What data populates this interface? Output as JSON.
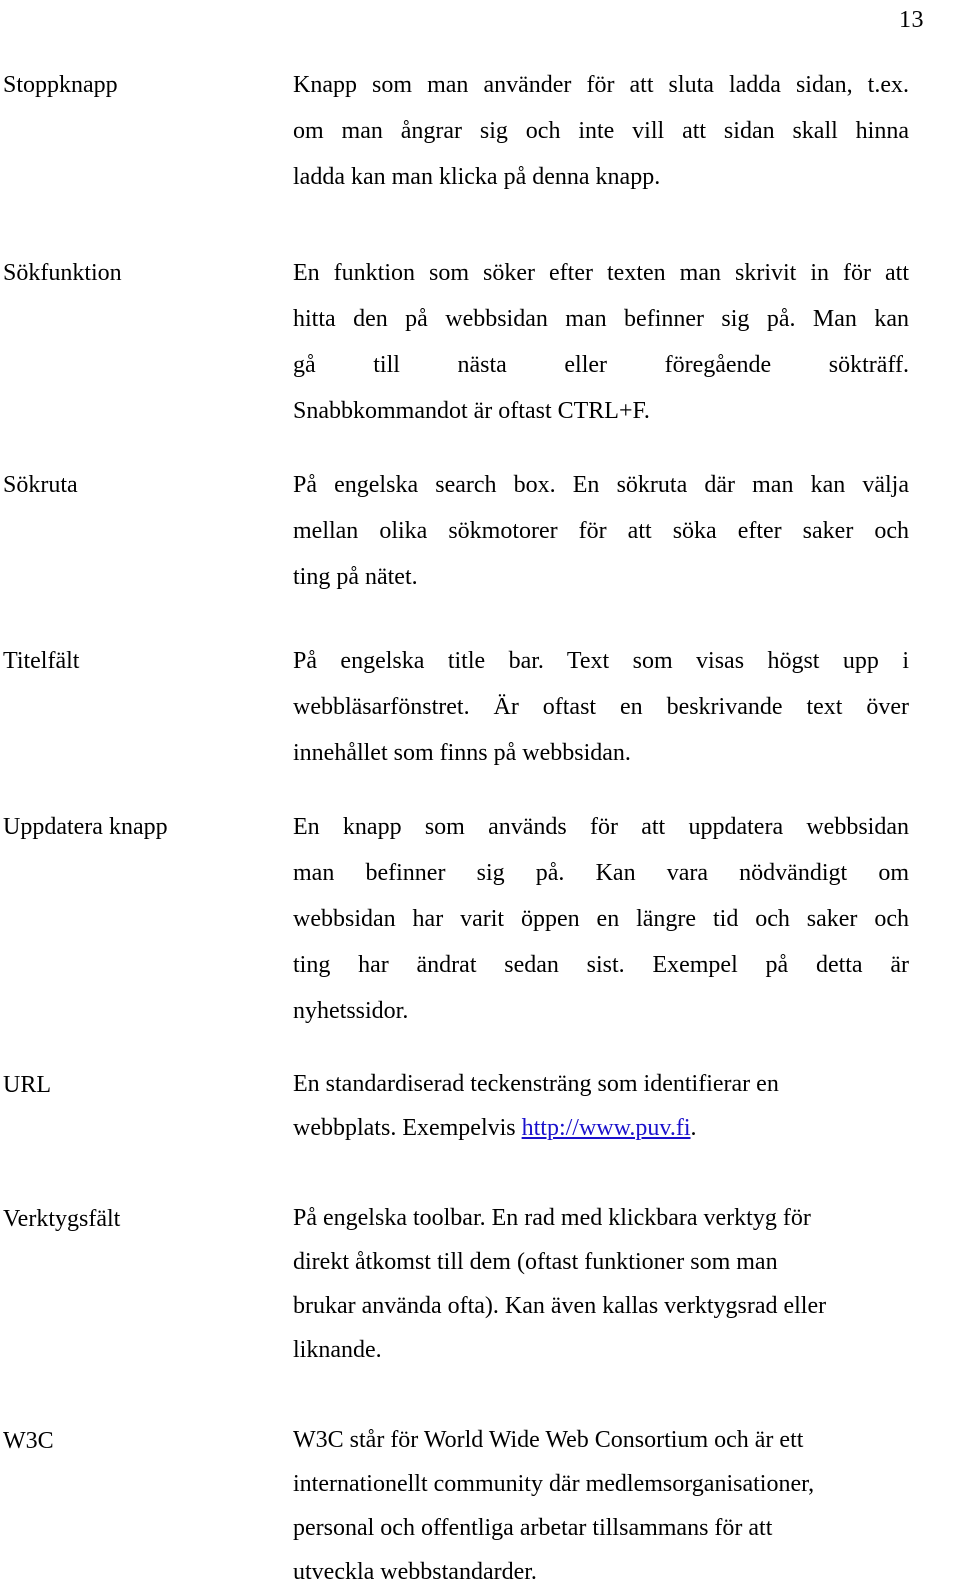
{
  "page": {
    "number": "13"
  },
  "entries": [
    {
      "term": "Stoppknapp",
      "lines": [
        "Knapp som man använder för att sluta ladda sidan, t.ex.",
        "om man ångrar sig och inte vill att sidan skall hinna",
        "ladda kan man klicka på denna knapp."
      ],
      "align": "justify"
    },
    {
      "term": "Sökfunktion",
      "lines": [
        "En funktion som söker efter texten man skrivit in för att",
        "hitta den på webbsidan man befinner sig på. Man kan",
        "gå till nästa eller föregående sökträff.",
        "Snabbkommandot är oftast CTRL+F."
      ],
      "align": "justify"
    },
    {
      "term": "Sökruta",
      "lines": [
        "På engelska search box. En sökruta där man kan välja",
        "mellan olika sökmotorer för att söka efter saker och",
        "ting på nätet."
      ],
      "align": "justify"
    },
    {
      "term": "Titelfält",
      "lines": [
        "På engelska title bar. Text som visas högst upp i",
        "webbläsarfönstret. Är oftast en beskrivande text över",
        "innehållet som finns på webbsidan."
      ],
      "align": "justify"
    },
    {
      "term": "Uppdatera knapp",
      "lines": [
        "En knapp som används för att uppdatera webbsidan",
        "man befinner sig på. Kan vara nödvändigt om",
        "webbsidan har varit öppen en längre tid och saker och",
        "ting har ändrat sedan sist. Exempel på detta är",
        "nyhetssidor."
      ],
      "align": "justify"
    },
    {
      "term": "URL",
      "lines": [
        "En standardiserad teckensträng som identifierar en"
      ],
      "line_with_link": {
        "before": "webbplats. Exempelvis ",
        "link": "http://www.puv.fi",
        "after": "."
      },
      "align": "ragged"
    },
    {
      "term": "Verktygsfält",
      "lines": [
        "På engelska toolbar. En rad med klickbara verktyg för",
        "direkt åtkomst till dem  (oftast funktioner som man",
        "brukar använda ofta). Kan även kallas verktygsrad eller",
        "liknande."
      ],
      "align": "ragged"
    },
    {
      "term": "W3C",
      "lines": [
        "W3C står för World Wide Web Consortium och är ett",
        "internationellt community där medlemsorganisationer,",
        "personal och offentliga arbetar tillsammans för att",
        "utveckla webbstandarder."
      ],
      "align": "ragged"
    }
  ]
}
